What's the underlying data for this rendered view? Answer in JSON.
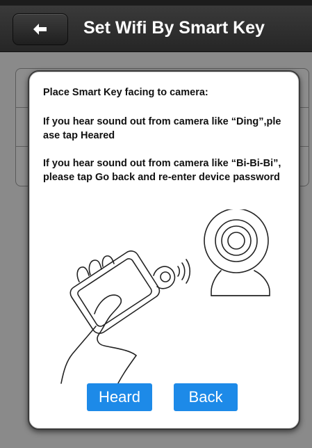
{
  "navbar": {
    "title": "Set Wifi By Smart Key",
    "back_icon": "back-arrow-icon"
  },
  "dialog": {
    "heading": "Place Smart Key facing to camera:",
    "message_1": "If you hear sound out from camera like “Ding”,please tap Heared",
    "message_2": "If you hear sound out from camera like “Bi-Bi-Bi”,please tap Go back and re-enter device password",
    "illustration_icon": "smart-key-camera-illustration",
    "heard_label": "Heard",
    "back_label": "Back"
  },
  "colors": {
    "navbar": "#2e2e2e",
    "overlay": "#8a8a8a",
    "button": "#1d8ae8"
  }
}
